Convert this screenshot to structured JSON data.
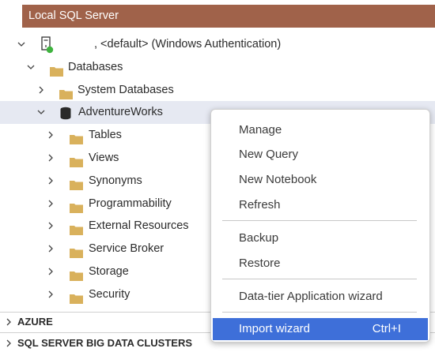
{
  "header": {
    "title": "Local SQL Server"
  },
  "tree": {
    "server": {
      "label": ", <default> (Windows Authentication)",
      "status_color": "#3fb33f"
    },
    "databases": {
      "label": "Databases"
    },
    "system_databases": {
      "label": "System Databases"
    },
    "adventureworks": {
      "label": "AdventureWorks"
    },
    "children": [
      {
        "label": "Tables"
      },
      {
        "label": "Views"
      },
      {
        "label": "Synonyms"
      },
      {
        "label": "Programmability"
      },
      {
        "label": "External Resources"
      },
      {
        "label": "Service Broker"
      },
      {
        "label": "Storage"
      },
      {
        "label": "Security"
      }
    ]
  },
  "bottom_sections": [
    {
      "label": "AZURE"
    },
    {
      "label": "SQL SERVER BIG DATA CLUSTERS"
    }
  ],
  "context_menu": {
    "groups": [
      [
        "Manage",
        "New Query",
        "New Notebook",
        "Refresh"
      ],
      [
        "Backup",
        "Restore"
      ],
      [
        "Data-tier Application wizard"
      ]
    ],
    "highlighted": {
      "label": "Import wizard",
      "shortcut": "Ctrl+I"
    }
  },
  "colors": {
    "header_bg": "#a0624a",
    "selected_row_bg": "#e6e9f2",
    "menu_highlight": "#3e6fd9",
    "folder": "#d9b15c"
  }
}
